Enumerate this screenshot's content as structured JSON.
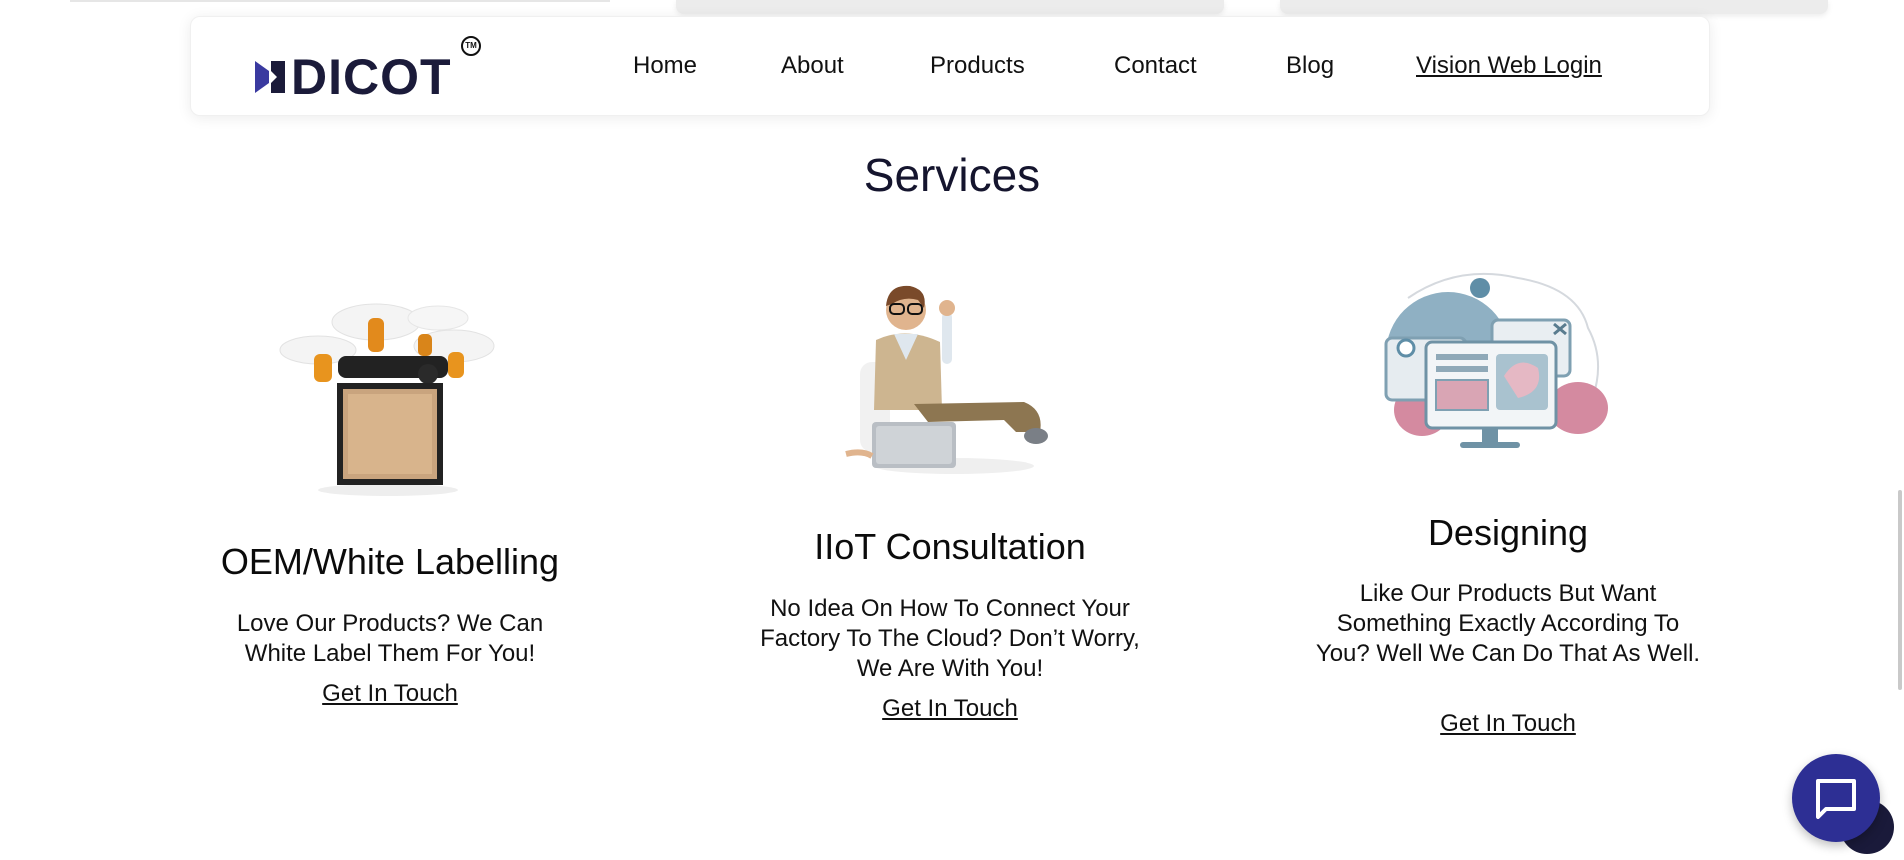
{
  "brand": {
    "name": "DICOT",
    "trademark": "TM"
  },
  "nav": {
    "items": [
      {
        "label": "Home"
      },
      {
        "label": "About"
      },
      {
        "label": "Products"
      },
      {
        "label": "Contact"
      },
      {
        "label": "Blog"
      }
    ],
    "login_label": "Vision Web Login"
  },
  "services": {
    "title": "Services",
    "items": [
      {
        "title": "OEM/White Labelling",
        "description": "Love Our Products? We Can White Label Them For You!",
        "link": "Get In Touch",
        "icon": "drone-delivery-icon"
      },
      {
        "title": "IIoT Consultation",
        "description": "No Idea On How To Connect Your Factory To The Cloud? Don’t Worry, We Are With You!",
        "link": "Get In Touch",
        "icon": "consultant-laptop-icon"
      },
      {
        "title": "Designing",
        "description": "Like Our Products But Want Something Exactly According To You? Well We Can Do That As Well.",
        "link": "Get In Touch",
        "icon": "design-screens-icon"
      }
    ]
  },
  "chat": {
    "icon": "chat-bubble-icon"
  },
  "colors": {
    "brand": "#1b1b3a",
    "accent": "#2d2f94",
    "logo_mark": "#3a3aa0"
  }
}
